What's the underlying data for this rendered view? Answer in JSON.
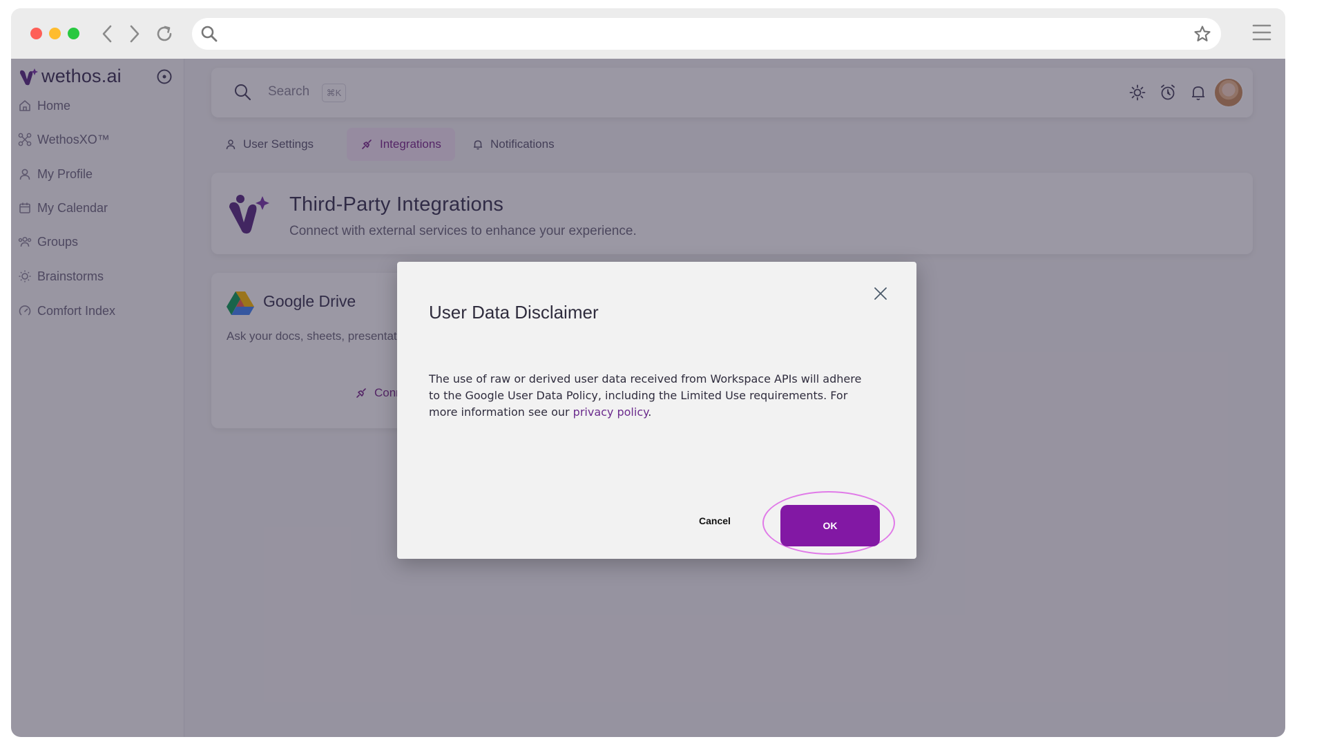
{
  "browser": {
    "address_placeholder": ""
  },
  "sidebar": {
    "brand": "wethos.ai",
    "items": [
      {
        "label": "Home",
        "icon": "home-icon"
      },
      {
        "label": "WethosXO™",
        "icon": "network-icon"
      },
      {
        "label": "My Profile",
        "icon": "user-icon"
      },
      {
        "label": "My Calendar",
        "icon": "calendar-icon"
      },
      {
        "label": "Groups",
        "icon": "groups-icon"
      },
      {
        "label": "Brainstorms",
        "icon": "lightbulb-icon"
      },
      {
        "label": "Comfort Index",
        "icon": "gauge-icon"
      }
    ]
  },
  "topbar": {
    "search_label": "Search",
    "search_shortcut": "⌘K"
  },
  "tabs": [
    {
      "label": "User Settings",
      "icon": "user-icon"
    },
    {
      "label": "Integrations",
      "icon": "plug-icon",
      "active": true
    },
    {
      "label": "Notifications",
      "icon": "bell-icon"
    }
  ],
  "integrations": {
    "title": "Third-Party Integrations",
    "subtitle": "Connect with external services to enhance your experience.",
    "google_drive": {
      "title": "Google Drive",
      "description": "Ask your docs, sheets, presentations and files anything.",
      "connect_label": "Connect"
    }
  },
  "modal": {
    "title": "User Data Disclaimer",
    "body_prefix": "The use of raw or derived user data received from Workspace APIs will adhere to the Google User Data Policy, including the Limited Use requirements. For more information see our ",
    "link_text": "privacy policy",
    "body_suffix": ".",
    "cancel_label": "Cancel",
    "ok_label": "OK"
  },
  "colors": {
    "accent": "#8218a4",
    "overlay": "#261e3a",
    "highlight_ring": "#e07ae8"
  }
}
